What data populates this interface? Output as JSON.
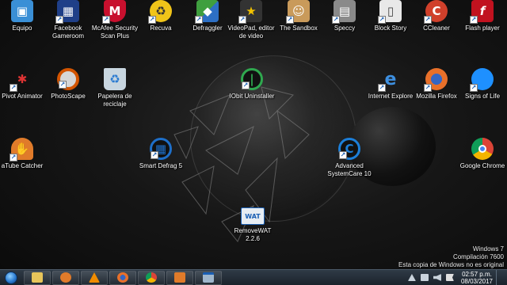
{
  "desktop_icons": [
    {
      "label": "Equipo",
      "icon": "computer-icon",
      "color": "#3a8fd6"
    },
    {
      "label": "Facebook Gameroom",
      "icon": "gameroom-icon",
      "color": "#1f3f88"
    },
    {
      "label": "McAfee Security Scan Plus",
      "icon": "mcafee-shield-icon",
      "color": "#c8102e"
    },
    {
      "label": "Recuva",
      "icon": "recuva-icon",
      "color": "#f0c419"
    },
    {
      "label": "Defraggler",
      "icon": "defraggler-icon",
      "color": "#3f9f3f"
    },
    {
      "label": "VideoPad, editor de video",
      "icon": "videopad-icon",
      "color": "#d9a400"
    },
    {
      "label": "The Sandbox",
      "icon": "sandbox-icon",
      "color": "#c99a5a"
    },
    {
      "label": "Speccy",
      "icon": "speccy-icon",
      "color": "#8a8a8a"
    },
    {
      "label": "Block Story",
      "icon": "blockstory-icon",
      "color": "#e8e8e8"
    },
    {
      "label": "CCleaner",
      "icon": "ccleaner-icon",
      "color": "#d0402b"
    },
    {
      "label": "Flash player",
      "icon": "flash-icon",
      "color": "#c1121f"
    },
    {
      "label": "Pivot Animator",
      "icon": "pivot-icon",
      "color": "#c0392b"
    },
    {
      "label": "PhotoScape",
      "icon": "photoscape-icon",
      "color": "#777777"
    },
    {
      "label": "Papelera de reciclaje",
      "icon": "recycle-bin-icon",
      "color": "#c8d6e0"
    },
    {
      "label": "IObit Uninstaller",
      "icon": "iobit-uninstaller-icon",
      "color": "#2fa84f"
    },
    {
      "label": "Internet Explore",
      "icon": "internet-explorer-icon",
      "color": "#2d7fd6"
    },
    {
      "label": "Mozilla Firefox",
      "icon": "firefox-icon",
      "color": "#e8702a"
    },
    {
      "label": "Signs of Life",
      "icon": "signs-of-life-icon",
      "color": "#1e90ff"
    },
    {
      "label": "aTube Catcher",
      "icon": "atube-catcher-icon",
      "color": "#e07b2a"
    },
    {
      "label": "Smart Defrag 5",
      "icon": "smart-defrag-icon",
      "color": "#1e6fc9"
    },
    {
      "label": "Advanced SystemCare 10",
      "icon": "advanced-systemcare-icon",
      "color": "#1c7fd9"
    },
    {
      "label": "Google Chrome",
      "icon": "chrome-icon",
      "color": "#4285f4"
    },
    {
      "label": "RemoveWAT 2.2.6",
      "icon": "removewat-icon",
      "color": "#e6ecf2"
    }
  ],
  "watermark": {
    "line1": "Windows 7",
    "line2": "Compilación 7600",
    "line3": "Esta copia de Windows no es original"
  },
  "taskbar": {
    "pinned": [
      {
        "icon": "windows-explorer-icon",
        "color": "#e8c55a"
      },
      {
        "icon": "media-player-icon",
        "color": "#e07b2a"
      },
      {
        "icon": "vlc-icon",
        "color": "#f08c00"
      },
      {
        "icon": "firefox-icon",
        "color": "#e8702a"
      },
      {
        "icon": "chrome-icon",
        "color": "#4285f4"
      },
      {
        "icon": "atube-catcher-icon",
        "color": "#e07b2a"
      },
      {
        "icon": "app-window-icon",
        "color": "#9fb6cc"
      }
    ],
    "clock_time": "02:57 p.m.",
    "clock_date": "08/03/2017"
  }
}
